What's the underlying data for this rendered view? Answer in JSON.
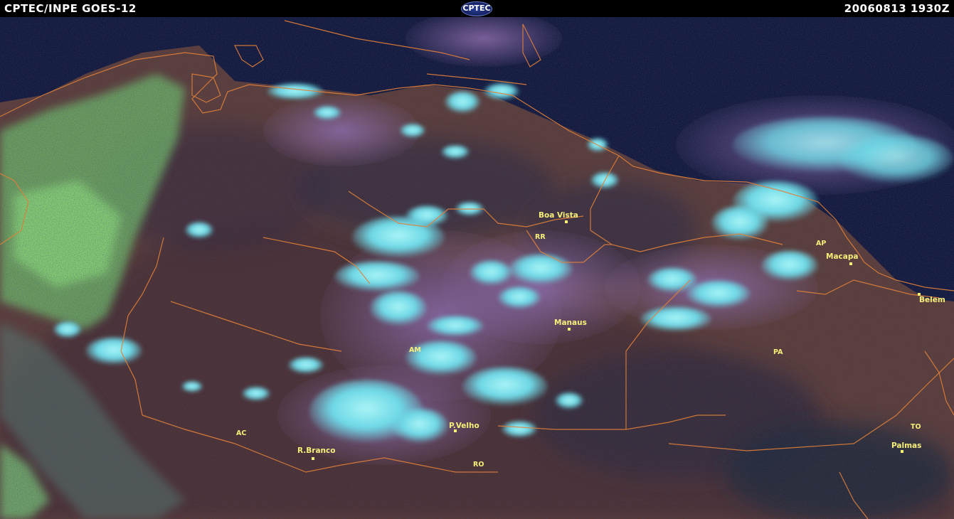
{
  "header": {
    "left_title": "CPTEC/INPE  GOES-12",
    "logo_text": "CPTEC",
    "right_title": "20060813  1930Z"
  },
  "cities": [
    {
      "id": "boa-vista",
      "label": "Boa Vista"
    },
    {
      "id": "macapa",
      "label": "Macapa"
    },
    {
      "id": "belem",
      "label": "Belem"
    },
    {
      "id": "manaus",
      "label": "Manaus"
    },
    {
      "id": "p-velho",
      "label": "P.Velho"
    },
    {
      "id": "r-branco",
      "label": "R.Branco"
    },
    {
      "id": "palmas",
      "label": "Palmas"
    }
  ],
  "states": [
    {
      "id": "rr",
      "label": "RR"
    },
    {
      "id": "ap",
      "label": "AP"
    },
    {
      "id": "am",
      "label": "AM"
    },
    {
      "id": "pa",
      "label": "PA"
    },
    {
      "id": "ac",
      "label": "AC"
    },
    {
      "id": "ro",
      "label": "RO"
    },
    {
      "id": "to",
      "label": "TO"
    }
  ],
  "colors": {
    "background": "#0d1230",
    "land": "#6a4a3a",
    "cloud_cyan": "#6ee0ea",
    "cloud_green": "#7ee08a",
    "borders": "#e0803a",
    "labels": "#f7ee7a"
  }
}
